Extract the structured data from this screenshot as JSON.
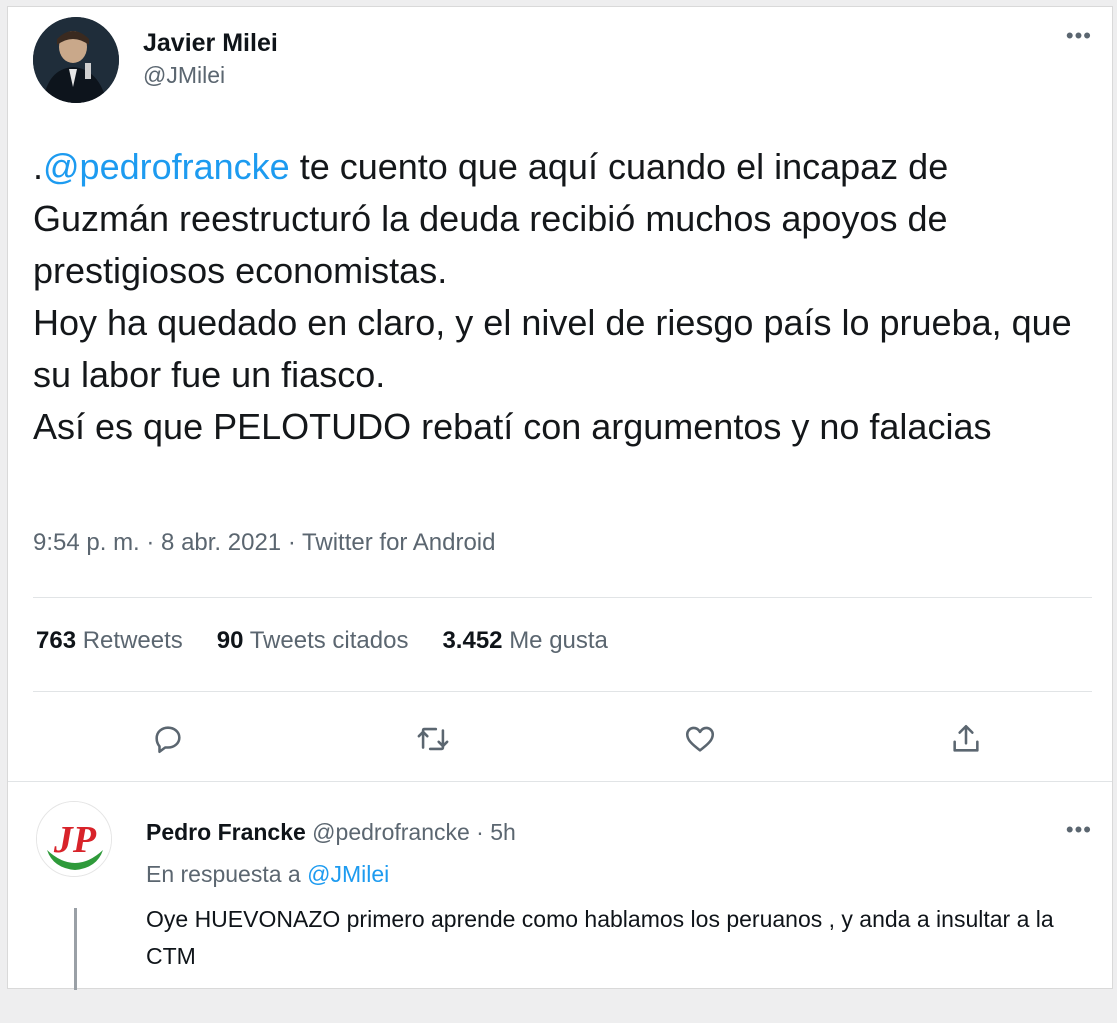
{
  "main_tweet": {
    "author_name": "Javier Milei",
    "author_handle": "@JMilei",
    "more_icon": "more-horizontal-icon",
    "text_prefix": ".",
    "mention": "@pedrofrancke",
    "text_body": " te cuento que aquí cuando el incapaz de Guzmán reestructuró la deuda recibió muchos apoyos de prestigiosos economistas.\nHoy ha quedado en claro, y el nivel de riesgo país lo prueba, que su labor fue un fiasco.\nAsí es que PELOTUDO rebatí con argumentos y no falacias",
    "meta": "9:54 p. m. · 8 abr. 2021 · Twitter for Android",
    "stats": {
      "retweets_count": "763",
      "retweets_label": "Retweets",
      "quotes_count": "90",
      "quotes_label": "Tweets citados",
      "likes_count": "3.452",
      "likes_label": "Me gusta"
    },
    "actions": [
      "reply-icon",
      "retweet-icon",
      "like-icon",
      "share-icon"
    ]
  },
  "reply": {
    "avatar_text": "JP",
    "author_name": "Pedro Francke",
    "author_handle_time": " @pedrofrancke · 5h",
    "reply_to_label": "En respuesta a ",
    "reply_to_handle": "@JMilei",
    "text": "Oye HUEVONAZO primero aprende como hablamos los peruanos , y anda a insultar a la CTM"
  },
  "colors": {
    "link": "#1d9bf0",
    "secondary_text": "#5b6670",
    "primary_text": "#0f1419",
    "reply_logo_red": "#d8232a",
    "reply_logo_green": "#2e9a3a"
  }
}
